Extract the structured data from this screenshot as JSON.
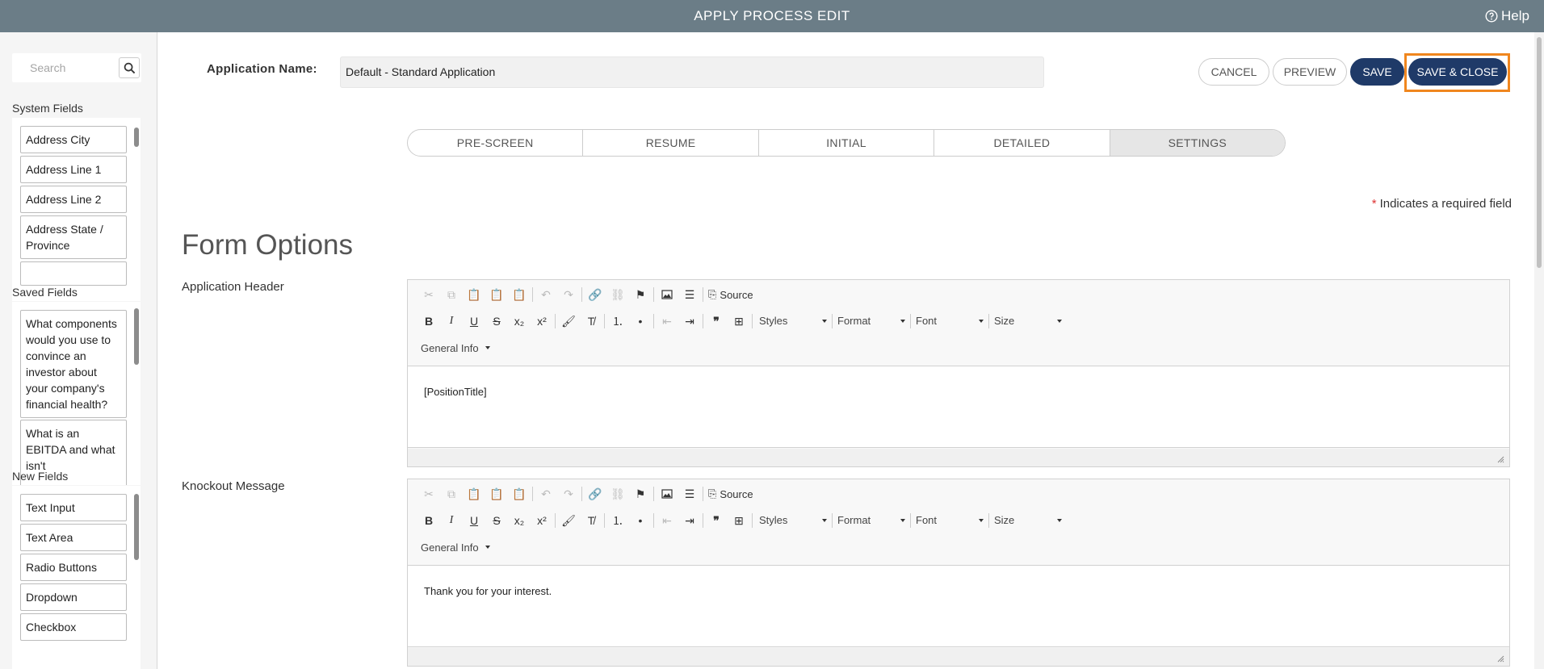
{
  "topbar": {
    "title": "APPLY PROCESS EDIT",
    "help": "Help"
  },
  "sidebar": {
    "search_placeholder": "Search",
    "system_fields": {
      "label": "System Fields",
      "items": [
        "Address City",
        "Address Line 1",
        "Address Line 2",
        "Address State / Province"
      ]
    },
    "saved_fields": {
      "label": "Saved Fields",
      "items": [
        "What components would you use to convince an investor about your company's financial health?",
        "What is an EBITDA and what isn't"
      ]
    },
    "new_fields": {
      "label": "New Fields",
      "items": [
        "Text Input",
        "Text Area",
        "Radio Buttons",
        "Dropdown",
        "Checkbox"
      ]
    }
  },
  "header": {
    "app_name_label": "Application Name:",
    "app_name_value": "Default - Standard Application",
    "buttons": {
      "cancel": "CANCEL",
      "preview": "PREVIEW",
      "save": "SAVE",
      "save_close": "SAVE & CLOSE"
    }
  },
  "tabs": [
    {
      "label": "PRE-SCREEN",
      "active": false
    },
    {
      "label": "RESUME",
      "active": false
    },
    {
      "label": "INITIAL",
      "active": false
    },
    {
      "label": "DETAILED",
      "active": false
    },
    {
      "label": "SETTINGS",
      "active": true
    }
  ],
  "required_note": {
    "star": "*",
    "text": "Indicates a required field"
  },
  "form_title": "Form Options",
  "editor_toolbar": {
    "source": "Source",
    "styles": "Styles",
    "format": "Format",
    "font": "Font",
    "size": "Size",
    "general_info": "General Info"
  },
  "editors": [
    {
      "label": "Application Header",
      "content": "[PositionTitle]"
    },
    {
      "label": "Knockout Message",
      "content": "Thank you for your interest."
    }
  ],
  "colors": {
    "topbar": "#6b7d87",
    "primary": "#1f3a68",
    "highlight": "#f0861e",
    "required": "#dd3333"
  }
}
